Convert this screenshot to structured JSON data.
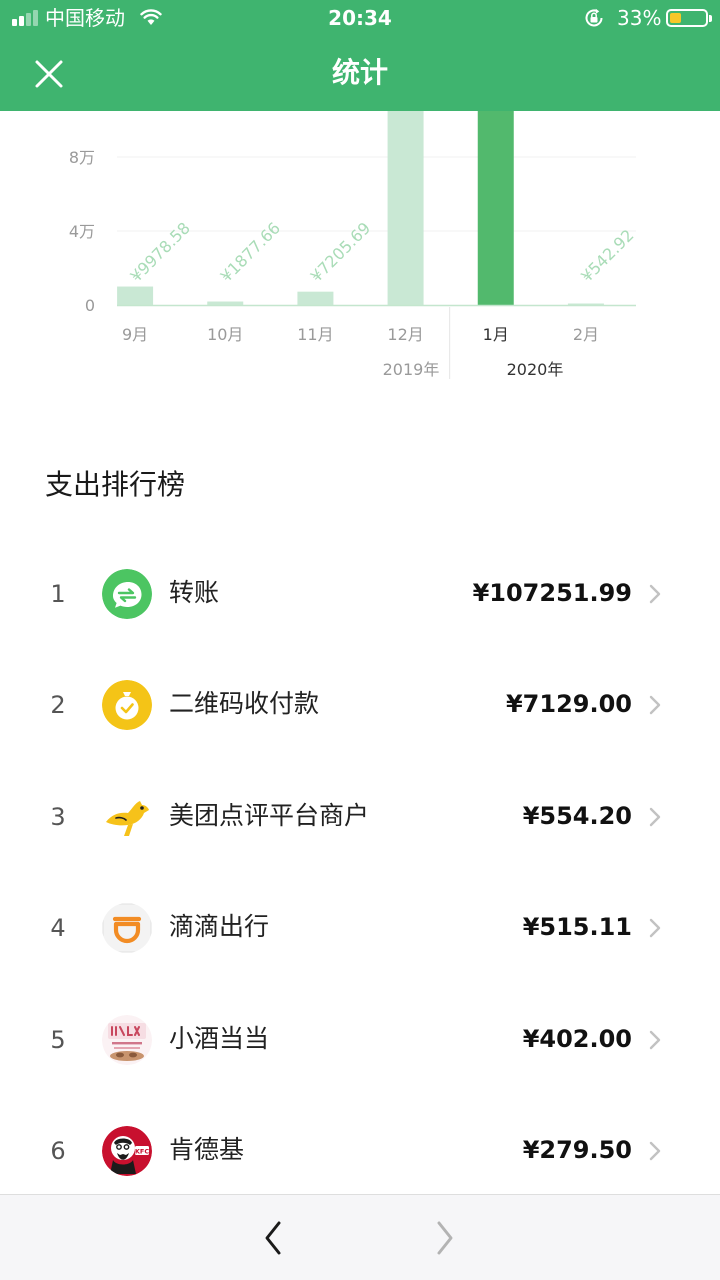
{
  "status_bar": {
    "carrier": "中国移动",
    "time": "20:34",
    "battery_percent": "33%",
    "battery_level": 0.33,
    "signal_bars_total": 4,
    "signal_bars_active": 2
  },
  "nav": {
    "title": "统计",
    "close_icon": "close-icon"
  },
  "chart_data": {
    "type": "bar",
    "categories": [
      "9月",
      "10月",
      "11月",
      "12月",
      "1月",
      "2月"
    ],
    "year_labels": [
      {
        "label": "2019年",
        "months": [
          "9月",
          "10月",
          "11月",
          "12月"
        ]
      },
      {
        "label": "2020年",
        "months": [
          "1月",
          "2月"
        ]
      }
    ],
    "values": [
      9978.58,
      1877.66,
      7205.69,
      105000,
      117000,
      542.92
    ],
    "value_labels": [
      "¥9978.58",
      "¥1877.66",
      "¥7205.69",
      "",
      "",
      "¥542.92"
    ],
    "highlight_index": 4,
    "y_ticks": [
      {
        "value": 0,
        "label": "0"
      },
      {
        "value": 40000,
        "label": "4万"
      },
      {
        "value": 80000,
        "label": "8万"
      }
    ],
    "ylim": [
      0,
      80000
    ],
    "grid": true,
    "colors": {
      "bar": "#c9e8d4",
      "highlight": "#52b96d",
      "label": "#a9dcb7",
      "axis": "#c4e6ce"
    }
  },
  "ranking": {
    "title": "支出排行榜",
    "items": [
      {
        "rank": "1",
        "name": "转账",
        "amount": "¥107251.99",
        "icon": "wechat-transfer-icon"
      },
      {
        "rank": "2",
        "name": "二维码收付款",
        "amount": "¥7129.00",
        "icon": "qr-payment-icon"
      },
      {
        "rank": "3",
        "name": "美团点评平台商户",
        "amount": "¥554.20",
        "icon": "meituan-kangaroo-icon"
      },
      {
        "rank": "4",
        "name": "滴滴出行",
        "amount": "¥515.11",
        "icon": "didi-icon"
      },
      {
        "rank": "5",
        "name": "小酒当当",
        "amount": "¥402.00",
        "icon": "xiaojiu-shop-icon"
      },
      {
        "rank": "6",
        "name": "肯德基",
        "amount": "¥279.50",
        "icon": "kfc-icon"
      }
    ]
  },
  "toolbar": {
    "back_icon": "chevron-left-icon",
    "forward_icon": "chevron-right-icon",
    "forward_enabled": false
  },
  "colors": {
    "brand": "#3fb46f",
    "bar": "#c9e8d4",
    "bar_highlight": "#52b96d",
    "battery": "#f7c72a"
  }
}
